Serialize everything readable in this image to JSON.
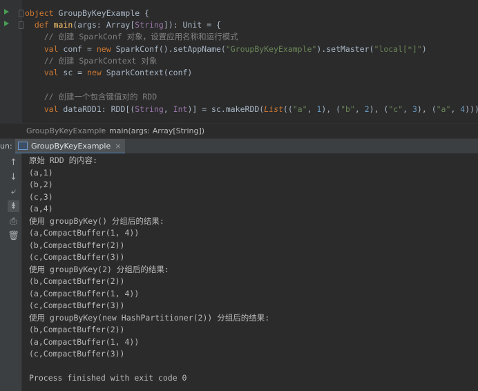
{
  "editor": {
    "lines": [
      [
        {
          "t": "object ",
          "c": "kw"
        },
        {
          "t": "GroupByKeyExample {",
          "c": ""
        }
      ],
      [
        {
          "t": "  def ",
          "c": "kw"
        },
        {
          "t": "main",
          "c": "fn"
        },
        {
          "t": "(args: ",
          "c": ""
        },
        {
          "t": "Array",
          "c": "ty"
        },
        {
          "t": "[",
          "c": ""
        },
        {
          "t": "String",
          "c": "ty2"
        },
        {
          "t": "]): ",
          "c": ""
        },
        {
          "t": "Unit",
          "c": "ty"
        },
        {
          "t": " = {",
          "c": ""
        }
      ],
      [
        {
          "t": "    // 创建 SparkConf 对象，设置应用名称和运行模式",
          "c": "com"
        }
      ],
      [
        {
          "t": "    val ",
          "c": "kw"
        },
        {
          "t": "conf = ",
          "c": ""
        },
        {
          "t": "new ",
          "c": "kw"
        },
        {
          "t": "SparkConf().setAppName(",
          "c": ""
        },
        {
          "t": "\"GroupByKeyExample\"",
          "c": "str"
        },
        {
          "t": ").setMaster(",
          "c": ""
        },
        {
          "t": "\"local[*]\"",
          "c": "str"
        },
        {
          "t": ")",
          "c": ""
        }
      ],
      [
        {
          "t": "    // 创建 SparkContext 对象",
          "c": "com"
        }
      ],
      [
        {
          "t": "    val ",
          "c": "kw"
        },
        {
          "t": "sc = ",
          "c": ""
        },
        {
          "t": "new ",
          "c": "kw"
        },
        {
          "t": "SparkContext(conf)",
          "c": ""
        }
      ],
      [
        {
          "t": "",
          "c": ""
        }
      ],
      [
        {
          "t": "    // 创建一个包含键值对的 RDD",
          "c": "com"
        }
      ],
      [
        {
          "t": "    val ",
          "c": "kw"
        },
        {
          "t": "dataRDD1: RDD[(",
          "c": ""
        },
        {
          "t": "String",
          "c": "ty2"
        },
        {
          "t": ", ",
          "c": ""
        },
        {
          "t": "Int",
          "c": "ty2"
        },
        {
          "t": ")] = sc.makeRDD(",
          "c": ""
        },
        {
          "t": "List",
          "c": "ital"
        },
        {
          "t": "((",
          "c": ""
        },
        {
          "t": "\"a\"",
          "c": "str"
        },
        {
          "t": ", ",
          "c": ""
        },
        {
          "t": "1",
          "c": "num"
        },
        {
          "t": "), (",
          "c": ""
        },
        {
          "t": "\"b\"",
          "c": "str"
        },
        {
          "t": ", ",
          "c": ""
        },
        {
          "t": "2",
          "c": "num"
        },
        {
          "t": "), (",
          "c": ""
        },
        {
          "t": "\"c\"",
          "c": "str"
        },
        {
          "t": ", ",
          "c": ""
        },
        {
          "t": "3",
          "c": "num"
        },
        {
          "t": "), (",
          "c": ""
        },
        {
          "t": "\"a\"",
          "c": "str"
        },
        {
          "t": ", ",
          "c": ""
        },
        {
          "t": "4",
          "c": "num"
        },
        {
          "t": ")))",
          "c": ""
        }
      ]
    ]
  },
  "breadcrumb": {
    "file": "GroupByKeyExample",
    "method": "main(args: Array[String])"
  },
  "run_panel": {
    "label": "un:",
    "tab_label": "GroupByKeyExample",
    "tab_close": "×",
    "toolbar_icons": [
      "up-arrow-icon",
      "down-arrow-icon",
      "soft-wrap-icon",
      "scroll-to-end-icon",
      "print-icon",
      "delete-icon"
    ]
  },
  "console": {
    "lines": [
      "原始 RDD 的内容:",
      "(a,1)",
      "(b,2)",
      "(c,3)",
      "(a,4)",
      "使用 groupByKey() 分组后的结果:",
      "(a,CompactBuffer(1, 4))",
      "(b,CompactBuffer(2))",
      "(c,CompactBuffer(3))",
      "使用 groupByKey(2) 分组后的结果:",
      "(b,CompactBuffer(2))",
      "(a,CompactBuffer(1, 4))",
      "(c,CompactBuffer(3))",
      "使用 groupByKey(new HashPartitioner(2)) 分组后的结果:",
      "(b,CompactBuffer(2))",
      "(a,CompactBuffer(1, 4))",
      "(c,CompactBuffer(3))",
      "",
      "Process finished with exit code 0"
    ]
  }
}
